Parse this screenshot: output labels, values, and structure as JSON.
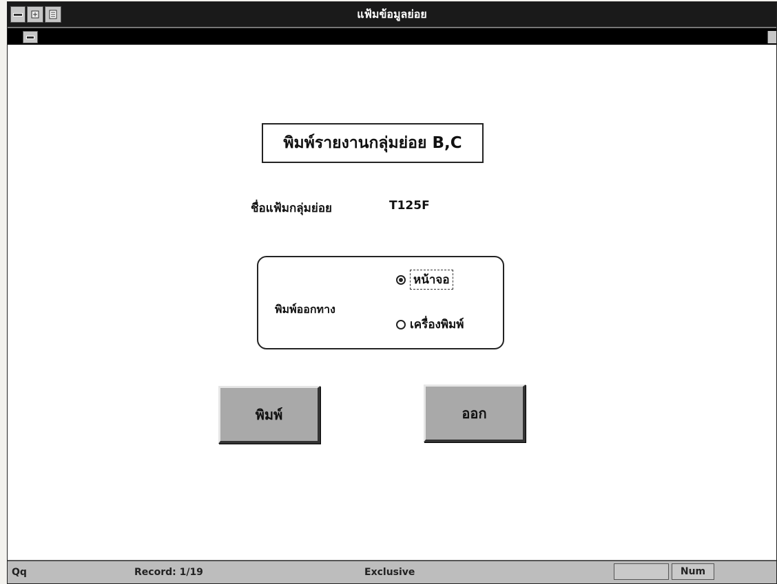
{
  "window": {
    "title": "แฟ้มข้อมูลย่อย"
  },
  "form": {
    "report_title": "พิมพ์รายงานกลุ่มย่อย B,C",
    "file_label": "ชื่อแฟ้มกลุ่มย่อย",
    "file_value": "T125F",
    "output_group_label": "พิมพ์ออกทาง",
    "options": [
      {
        "label": "หน้าจอ",
        "selected": true
      },
      {
        "label": "เครื่องพิมพ์",
        "selected": false
      }
    ],
    "print_button": "พิมพ์",
    "exit_button": "ออก"
  },
  "status": {
    "mode": "Qq",
    "record": "Record: 1/19",
    "lock": "Exclusive",
    "num": "Num"
  },
  "icons": [
    "control-menu-icon",
    "restore-icon",
    "list-icon",
    "scroll-arrow-icon"
  ]
}
